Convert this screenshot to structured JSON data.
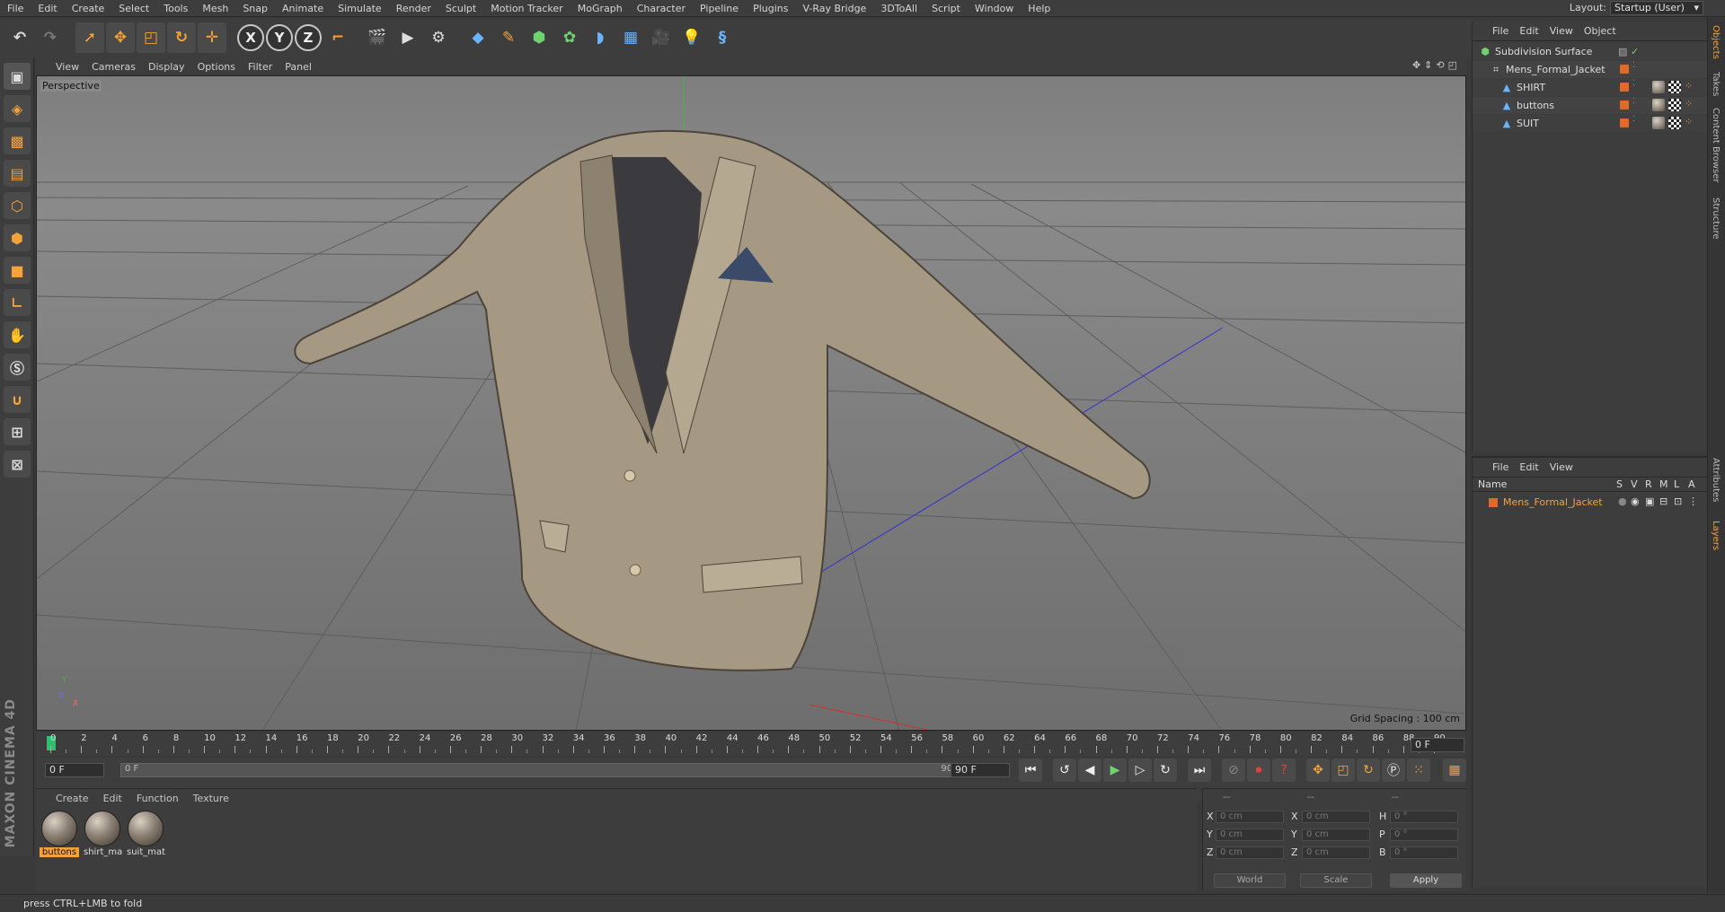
{
  "menu": [
    "File",
    "Edit",
    "Create",
    "Select",
    "Tools",
    "Mesh",
    "Snap",
    "Animate",
    "Simulate",
    "Render",
    "Sculpt",
    "Motion Tracker",
    "MoGraph",
    "Character",
    "Pipeline",
    "Plugins",
    "V-Ray Bridge",
    "3DToAll",
    "Script",
    "Window",
    "Help"
  ],
  "layout": {
    "label": "Layout:",
    "value": "Startup (User)"
  },
  "toolbar": {
    "x": "X",
    "y": "Y",
    "z": "Z"
  },
  "viewport": {
    "menu": [
      "View",
      "Cameras",
      "Display",
      "Options",
      "Filter",
      "Panel"
    ],
    "label": "Perspective",
    "grid_spacing": "Grid Spacing : 100 cm",
    "axis_y": "Y",
    "axis_z": "Z",
    "axis_x": "X"
  },
  "timeline": {
    "ticks": [
      "0",
      "2",
      "4",
      "6",
      "8",
      "10",
      "12",
      "14",
      "16",
      "18",
      "20",
      "22",
      "24",
      "26",
      "28",
      "30",
      "32",
      "34",
      "36",
      "38",
      "40",
      "42",
      "44",
      "46",
      "48",
      "50",
      "52",
      "54",
      "56",
      "58",
      "60",
      "62",
      "64",
      "66",
      "68",
      "70",
      "72",
      "74",
      "76",
      "78",
      "80",
      "82",
      "84",
      "86",
      "88",
      "90"
    ],
    "current": "0 F",
    "start": "0 F",
    "range_start": "0 F",
    "range_end": "90 F",
    "end": "90 F"
  },
  "materials": {
    "menu": [
      "Create",
      "Edit",
      "Function",
      "Texture"
    ],
    "items": [
      {
        "name": "buttons",
        "selected": true
      },
      {
        "name": "shirt_ma",
        "selected": false
      },
      {
        "name": "suit_mat",
        "selected": false
      }
    ]
  },
  "coords": {
    "header": [
      "--",
      "--",
      "--"
    ],
    "rows": [
      {
        "l1": "X",
        "v1": "0 cm",
        "l2": "X",
        "v2": "0 cm",
        "l3": "H",
        "v3": "0 °"
      },
      {
        "l1": "Y",
        "v1": "0 cm",
        "l2": "Y",
        "v2": "0 cm",
        "l3": "P",
        "v3": "0 °"
      },
      {
        "l1": "Z",
        "v1": "0 cm",
        "l2": "Z",
        "v2": "0 cm",
        "l3": "B",
        "v3": "0 °"
      }
    ],
    "world": "World",
    "scale": "Scale",
    "apply": "Apply"
  },
  "objects": {
    "menu": [
      "File",
      "Edit",
      "View",
      "Object"
    ],
    "tree": [
      {
        "name": "Subdivision Surface",
        "indent": 0,
        "icon": "subdivision-icon"
      },
      {
        "name": "Mens_Formal_Jacket",
        "indent": 1,
        "icon": "null-object-icon"
      },
      {
        "name": "SHIRT",
        "indent": 2,
        "icon": "polygon-object-icon"
      },
      {
        "name": "buttons",
        "indent": 2,
        "icon": "polygon-object-icon"
      },
      {
        "name": "SUIT",
        "indent": 2,
        "icon": "polygon-object-icon"
      }
    ]
  },
  "layers": {
    "menu": [
      "File",
      "Edit",
      "View"
    ],
    "columns": {
      "name": "Name",
      "s": "S",
      "v": "V",
      "r": "R",
      "m": "M",
      "l": "L",
      "a": "A"
    },
    "rows": [
      {
        "name": "Mens_Formal_Jacket"
      }
    ]
  },
  "side_tabs": [
    "Objects",
    "Takes",
    "Content Browser",
    "Structure",
    "Attributes",
    "Layers"
  ],
  "branding": "MAXON CINEMA 4D",
  "status": "press CTRL+LMB to fold",
  "colors": {
    "accent": "#f3a23c",
    "layer_color": "#e06a2a"
  }
}
